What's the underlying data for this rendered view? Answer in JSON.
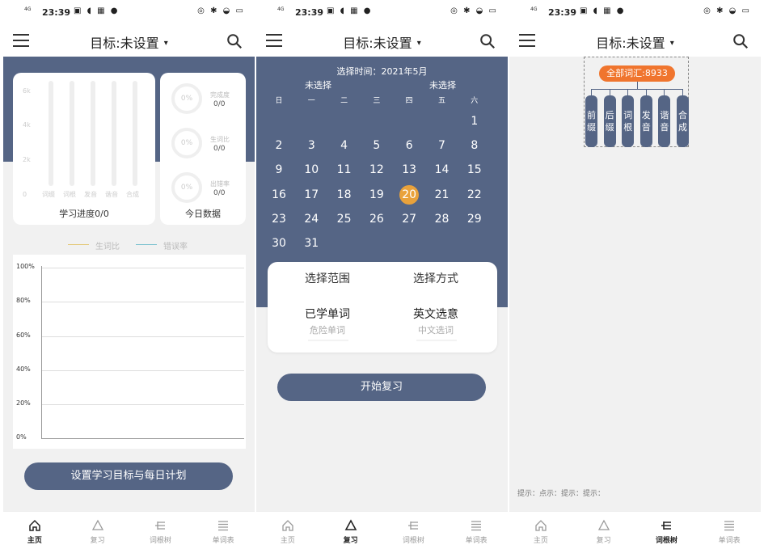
{
  "status": {
    "time": "23:39",
    "signal": "4G",
    "signal_sub": "ııl"
  },
  "appbar": {
    "title": "目标:未设置",
    "caret": "▾"
  },
  "nav": [
    {
      "label": "主页",
      "icon": "home-icon"
    },
    {
      "label": "复习",
      "icon": "recycle-icon"
    },
    {
      "label": "词根树",
      "icon": "tree-icon"
    },
    {
      "label": "单词表",
      "icon": "list-icon"
    }
  ],
  "home": {
    "bar_yticks": [
      "6k",
      "4k",
      "2k",
      "0"
    ],
    "bar_xlabels": [
      "词缀",
      "词根",
      "发音",
      "谐音",
      "合成"
    ],
    "bar_caption": "学习进度0/0",
    "today": [
      {
        "pct": "0%",
        "label": "完成度",
        "value": "0/0"
      },
      {
        "pct": "0%",
        "label": "生词比",
        "value": "0/0"
      },
      {
        "pct": "0%",
        "label": "出错率",
        "value": "0/0"
      }
    ],
    "today_caption": "今日数据",
    "legend": [
      {
        "name": "生词比",
        "color": "#e4c97a"
      },
      {
        "name": "错误率",
        "color": "#7dc2cf"
      }
    ],
    "button": "设置学习目标与每日计划"
  },
  "chart_data": {
    "type": "line",
    "title": "",
    "xlabel": "",
    "ylabel": "",
    "yticks": [
      "100%",
      "80%",
      "60%",
      "40%",
      "20%",
      "0%"
    ],
    "ylim": [
      0,
      100
    ],
    "series": [
      {
        "name": "生词比",
        "values": []
      },
      {
        "name": "错误率",
        "values": []
      }
    ]
  },
  "review": {
    "header": "选择时间：2021年5月",
    "unselected_left": "未选择",
    "unselected_right": "未选择",
    "weekdays": [
      "日",
      "一",
      "二",
      "三",
      "四",
      "五",
      "六"
    ],
    "first_weekday": 6,
    "days": [
      "1",
      "2",
      "3",
      "4",
      "5",
      "6",
      "7",
      "8",
      "9",
      "10",
      "11",
      "12",
      "13",
      "14",
      "15",
      "16",
      "17",
      "18",
      "19",
      "20",
      "21",
      "22",
      "23",
      "24",
      "25",
      "26",
      "27",
      "28",
      "29",
      "30",
      "31"
    ],
    "selected_day": "20",
    "range_title": "选择范围",
    "mode_title": "选择方式",
    "range_value": "已学单词",
    "range_alt": "危险单词",
    "mode_value": "英文选意",
    "mode_alt": "中文选词",
    "start_button": "开始复习"
  },
  "tree": {
    "root": "全部词汇:8933",
    "children": [
      "前缀",
      "后缀",
      "词根",
      "发音",
      "谐音",
      "合成"
    ],
    "hint": "提示：点示：提示：提示："
  },
  "colors": {
    "primary": "#556585",
    "accent": "#e9a23b",
    "root": "#f0752e"
  }
}
